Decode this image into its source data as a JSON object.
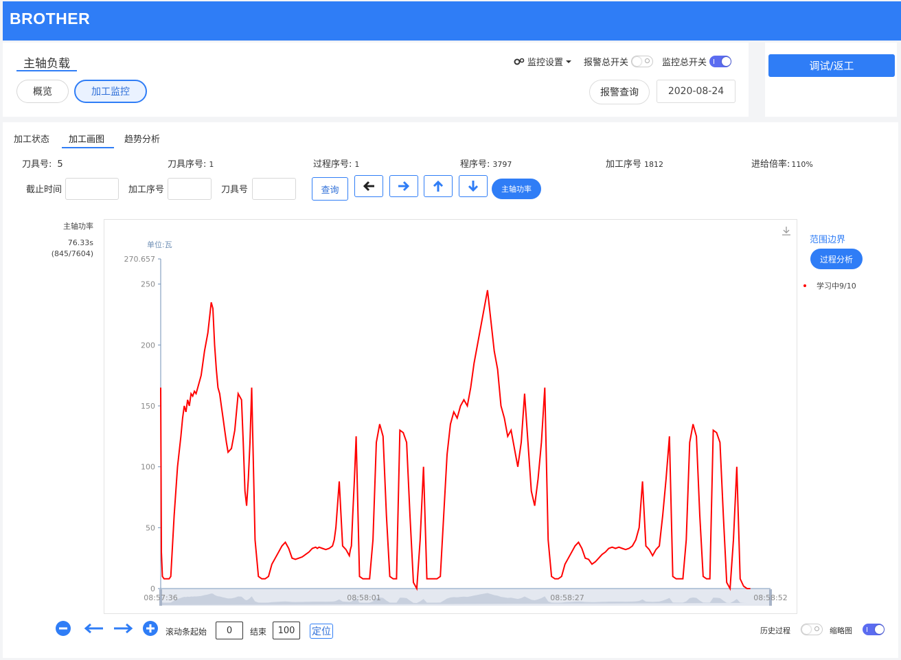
{
  "brand": "BROTHER",
  "header": {
    "page_title": "主轴负载",
    "view_buttons": [
      "概览",
      "加工监控"
    ],
    "monitor_settings": "监控设置",
    "alarm_switch_label": "报警总开关",
    "monitor_switch_label": "监控总开关",
    "alarm_query": "报警查询",
    "date": "2020-08-24",
    "debug_return": "调试/返工"
  },
  "tabs": [
    "加工状态",
    "加工画图",
    "趋势分析"
  ],
  "info": {
    "tool_no_label": "刀具号:",
    "tool_no": "5",
    "tool_seq_label": "刀具序号:",
    "tool_seq": "1",
    "process_seq_label": "过程序号:",
    "process_seq": "1",
    "program_no_label": "程序号:",
    "program_no": "3797",
    "machining_seq_label": "加工序号",
    "machining_seq": "1812",
    "feed_rate_label": "进给倍率:",
    "feed_rate": "110%"
  },
  "filters": {
    "deadline_label": "截止时间",
    "machining_seq_label": "加工序号",
    "tool_no_label": "刀具号",
    "query": "查询",
    "spindle_power": "主轴功率"
  },
  "side": {
    "metric": "主轴功率",
    "time": "76.33s",
    "index": "(845/7604)"
  },
  "legend": {
    "range_boundary": "范围边界",
    "process_analysis": "过程分析",
    "learning": "学习中9/10"
  },
  "bottom": {
    "scroll_start_label": "滚动条起始",
    "scroll_start": "0",
    "end_label": "结束",
    "end": "100",
    "locate": "定位",
    "history_label": "历史过程",
    "thumbnail_label": "缩略图"
  },
  "chart_data": {
    "type": "line",
    "unit_label": "单位:瓦",
    "ylim": [
      0,
      270.657
    ],
    "yticks": [
      0,
      50,
      100,
      150,
      200,
      250
    ],
    "ymax_label": "270.657",
    "x_tick_labels": [
      "08:57:36",
      "08:58:01",
      "08:58:27",
      "08:58:52"
    ],
    "line_color": "#ff0000",
    "x": [
      0,
      0.2,
      0.5,
      1,
      2,
      2.5,
      3,
      4,
      5,
      6,
      6.5,
      7,
      7.5,
      8,
      8.5,
      9,
      9.5,
      10,
      10.5,
      11,
      12,
      13,
      14,
      15,
      15.5,
      16,
      16.5,
      17,
      17.5,
      18,
      18.5,
      19,
      19.5,
      20,
      21,
      22,
      23,
      24,
      24.5,
      25,
      25.5,
      26,
      26.5,
      27,
      28,
      29,
      30,
      31,
      32,
      33,
      34,
      35,
      36,
      37,
      38,
      39,
      40,
      41,
      42,
      43,
      44,
      45,
      46,
      46.5,
      47,
      48,
      49,
      50,
      51,
      51.5,
      52,
      53,
      54,
      55,
      56,
      56.3,
      56.6,
      57,
      57.5,
      58,
      59,
      60,
      61,
      62,
      63,
      64,
      65,
      66,
      67,
      68,
      69,
      70,
      71,
      72,
      73,
      74,
      75,
      76,
      77,
      78,
      79,
      80,
      81,
      82,
      83,
      84,
      85,
      86,
      87,
      88,
      89,
      90,
      91,
      92,
      93,
      94,
      95,
      96,
      97,
      98,
      99,
      100,
      101,
      102,
      103,
      104,
      105,
      106,
      107,
      108,
      109,
      110,
      111,
      112,
      113,
      114,
      115,
      116,
      117,
      118,
      119,
      120,
      121,
      122,
      123,
      124,
      125,
      126,
      127,
      128,
      129,
      130,
      131,
      132,
      133,
      134,
      135,
      136,
      137,
      138,
      139,
      140,
      141,
      142,
      143,
      144,
      145,
      146,
      147,
      148,
      149,
      150,
      151,
      152,
      153,
      154,
      155,
      156,
      157,
      158,
      159,
      160,
      161,
      162,
      163,
      164,
      165,
      166,
      167,
      168,
      169,
      170,
      171,
      172,
      173,
      174,
      175,
      176,
      177,
      178,
      178.5,
      179,
      179.5,
      180,
      180.5,
      181
    ],
    "y": [
      165,
      30,
      10,
      8,
      8,
      8,
      10,
      60,
      100,
      125,
      140,
      150,
      145,
      155,
      150,
      160,
      158,
      162,
      160,
      165,
      175,
      195,
      210,
      235,
      230,
      200,
      180,
      165,
      160,
      150,
      140,
      130,
      120,
      112,
      115,
      130,
      160,
      155,
      120,
      80,
      68,
      90,
      120,
      165,
      40,
      10,
      8,
      8,
      10,
      20,
      25,
      30,
      35,
      38,
      33,
      25,
      24,
      25,
      26,
      28,
      30,
      33,
      34,
      33,
      34,
      33,
      32,
      33,
      35,
      40,
      50,
      88,
      35,
      32,
      27,
      32,
      35,
      60,
      90,
      125,
      10,
      8,
      8,
      8,
      40,
      120,
      135,
      125,
      60,
      10,
      8,
      8,
      130,
      128,
      120,
      60,
      5,
      0,
      40,
      100,
      8,
      8,
      8,
      8,
      10,
      60,
      110,
      135,
      145,
      140,
      150,
      155,
      150,
      165,
      185,
      200,
      215,
      230,
      245,
      220,
      195,
      180,
      150,
      140,
      125,
      130,
      115,
      100,
      120,
      160,
      120,
      80,
      68,
      90,
      120,
      165,
      40,
      10,
      8,
      8,
      10,
      20,
      25,
      30,
      35,
      38,
      33,
      25,
      24,
      20,
      22,
      25,
      28,
      30,
      33,
      34,
      33,
      34,
      33,
      32,
      33,
      35,
      40,
      50,
      88,
      35,
      32,
      27,
      32,
      35,
      60,
      90,
      125,
      10,
      8,
      8,
      8,
      40,
      120,
      135,
      125,
      60,
      10,
      8,
      8,
      130,
      128,
      120,
      60,
      5,
      0,
      40,
      100,
      8,
      2,
      0,
      0
    ]
  }
}
